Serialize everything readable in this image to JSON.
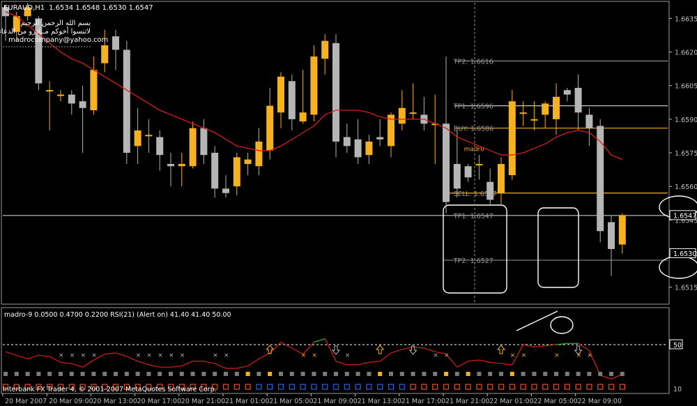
{
  "chart_data": {
    "type": "candlestick",
    "header": {
      "symbol": "EURAUD,H1",
      "ohlc": "1.6534 1.6548 1.6530 1.6547",
      "line1": "بسم الله الرحمن الرحيم",
      "line2": "لاتنسوا أخوكم مــادرو من الدعاء",
      "line3": "madrocompany@yahoo.com"
    },
    "ylim": [
      1.6508,
      1.6642
    ],
    "y_ticks": [
      "1.6650",
      "1.6635",
      "1.6620",
      "1.6605",
      "1.6590",
      "1.6575",
      "1.6560",
      "1.6545",
      "1.6530",
      "1.6515"
    ],
    "y_tick_values": [
      1.665,
      1.6635,
      1.662,
      1.6605,
      1.659,
      1.6575,
      1.656,
      1.6545,
      1.653,
      1.6515
    ],
    "price_badges": [
      {
        "label": "1.6547",
        "value": 1.6547
      },
      {
        "label": "1.6530",
        "value": 1.653
      }
    ],
    "x_ticks": [
      "20 Mar 2007",
      "20 Mar 09:00",
      "20 Mar 13:00",
      "20 Mar 17:00",
      "20 Mar 21:00",
      "21 Mar 01:00",
      "21 Mar 05:00",
      "21 Mar 09:00",
      "21 Mar 13:00",
      "21 Mar 17:00",
      "21 Mar 21:00",
      "22 Mar 01:00",
      "22 Mar 05:00",
      "22 Mar 09:00"
    ],
    "candles": [
      [
        1.664,
        1.6636,
        1.6641,
        1.6625
      ],
      [
        1.6629,
        1.6636,
        1.6638,
        1.6625
      ],
      [
        1.6636,
        1.664,
        1.6642,
        1.6634
      ],
      [
        1.6635,
        1.6606,
        1.6636,
        1.6603
      ],
      [
        1.6603,
        1.6603,
        1.6607,
        1.6585
      ],
      [
        1.6601,
        1.6601,
        1.6603,
        1.6598
      ],
      [
        1.6601,
        1.6597,
        1.6603,
        1.6592
      ],
      [
        1.6598,
        1.6595,
        1.6605,
        1.6575
      ],
      [
        1.6594,
        1.6612,
        1.6618,
        1.6592
      ],
      [
        1.6615,
        1.6623,
        1.663,
        1.6611
      ],
      [
        1.6627,
        1.6621,
        1.663,
        1.6612
      ],
      [
        1.6621,
        1.6575,
        1.6625,
        1.657
      ],
      [
        1.6578,
        1.6585,
        1.6595,
        1.657
      ],
      [
        1.6583,
        1.6583,
        1.659,
        1.6575
      ],
      [
        1.6582,
        1.6574,
        1.6585,
        1.6567
      ],
      [
        1.657,
        1.6569,
        1.6575,
        1.656
      ],
      [
        1.6569,
        1.657,
        1.6575,
        1.656
      ],
      [
        1.6569,
        1.6586,
        1.6589,
        1.6568
      ],
      [
        1.6586,
        1.6574,
        1.659,
        1.657
      ],
      [
        1.6575,
        1.6559,
        1.6578,
        1.6555
      ],
      [
        1.6559,
        1.6557,
        1.6565,
        1.6555
      ],
      [
        1.656,
        1.6573,
        1.6575,
        1.6556
      ],
      [
        1.657,
        1.6572,
        1.6575,
        1.6565
      ],
      [
        1.6569,
        1.658,
        1.6586,
        1.6565
      ],
      [
        1.6576,
        1.6596,
        1.6604,
        1.6572
      ],
      [
        1.6593,
        1.6609,
        1.6611,
        1.6586
      ],
      [
        1.6607,
        1.659,
        1.661,
        1.6585
      ],
      [
        1.6589,
        1.6593,
        1.6612,
        1.6588
      ],
      [
        1.6592,
        1.6618,
        1.6623,
        1.6589
      ],
      [
        1.6617,
        1.6625,
        1.6628,
        1.661
      ],
      [
        1.6624,
        1.658,
        1.6628,
        1.6573
      ],
      [
        1.6582,
        1.6578,
        1.6588,
        1.6575
      ],
      [
        1.6581,
        1.6573,
        1.659,
        1.657
      ],
      [
        1.6574,
        1.658,
        1.6583,
        1.657
      ],
      [
        1.6582,
        1.6581,
        1.659,
        1.6578
      ],
      [
        1.6578,
        1.6592,
        1.6593,
        1.6573
      ],
      [
        1.6588,
        1.6595,
        1.6603,
        1.6585
      ],
      [
        1.6593,
        1.6593,
        1.6606,
        1.659
      ],
      [
        1.6592,
        1.6588,
        1.66,
        1.6585
      ],
      [
        1.6588,
        1.6588,
        1.6601,
        1.657
      ],
      [
        1.6588,
        1.6553,
        1.6618,
        1.6548
      ],
      [
        1.657,
        1.6559,
        1.6585,
        1.6555
      ],
      [
        1.6569,
        1.6564,
        1.657,
        1.6562
      ],
      [
        1.657,
        1.657,
        1.6574,
        1.6563
      ],
      [
        1.6562,
        1.6554,
        1.6568,
        1.6552
      ],
      [
        1.6557,
        1.657,
        1.6573,
        1.6552
      ],
      [
        1.6565,
        1.6598,
        1.6603,
        1.6563
      ],
      [
        1.6593,
        1.6593,
        1.6598,
        1.6587
      ],
      [
        1.659,
        1.659,
        1.6598,
        1.6585
      ],
      [
        1.6592,
        1.6597,
        1.6598,
        1.6586
      ],
      [
        1.659,
        1.66,
        1.6606,
        1.6583
      ],
      [
        1.6603,
        1.6601,
        1.6604,
        1.6598
      ],
      [
        1.6604,
        1.6593,
        1.661,
        1.6585
      ],
      [
        1.6592,
        1.6586,
        1.6595,
        1.6578
      ],
      [
        1.6587,
        1.654,
        1.659,
        1.6535
      ],
      [
        1.6544,
        1.6532,
        1.6547,
        1.652
      ],
      [
        1.6534,
        1.6547,
        1.6548,
        1.653
      ]
    ],
    "ma_series": {
      "name": "",
      "values": [
        1.6638,
        1.6636,
        1.6632,
        1.6628,
        1.6624,
        1.662,
        1.6617,
        1.6615,
        1.6612,
        1.6609,
        1.6606,
        1.6603,
        1.66,
        1.6597,
        1.6594,
        1.6592,
        1.659,
        1.6588,
        1.6586,
        1.6584,
        1.6581,
        1.6578,
        1.6577,
        1.6576,
        1.6576,
        1.6578,
        1.6581,
        1.6584,
        1.6587,
        1.6592,
        1.6594,
        1.6594,
        1.6594,
        1.6593,
        1.6591,
        1.659,
        1.659,
        1.659,
        1.659,
        1.6588,
        1.6586,
        1.6582,
        1.658,
        1.6578,
        1.6576,
        1.6574,
        1.6574,
        1.6575,
        1.6577,
        1.6579,
        1.6582,
        1.6584,
        1.6585,
        1.6584,
        1.658,
        1.6574,
        1.6572
      ]
    },
    "levels": [
      {
        "label": "TP2: 1.6616",
        "value": 1.6616,
        "color": "#9a9a9a",
        "start": 41
      },
      {
        "label": "TP1: 1.6596",
        "value": 1.6596,
        "color": "#c8c8c8",
        "start": 41
      },
      {
        "label": "BUY: 1.6586",
        "value": 1.6586,
        "color": "#f5b120",
        "start": 41
      },
      {
        "label": "SELL: 1.6557",
        "value": 1.6557,
        "color": "#f5b120",
        "start": 40
      },
      {
        "label": "TP1: 1.6547",
        "value": 1.6547,
        "color": "#b4b4b4",
        "start": 0
      },
      {
        "label": "TP2: 1.6527",
        "value": 1.6527,
        "color": "#7a7a7a",
        "start": 40
      }
    ],
    "signal_label": "madro",
    "colors": {
      "bull": "#f5b120",
      "bear": "#b5b5b5",
      "ma": "#d8201a",
      "axis": "#c0c0c0",
      "rsi_up": "#22c422",
      "rsi_down": "#d8201a",
      "arrow": "#f5b120"
    },
    "indicator": {
      "title": "madro-9 0.0500 0.4700 0.2200  RSI(21) (Alert on) 41.40 41.40 50.00",
      "ylim": [
        10,
        80
      ],
      "level": 50,
      "level_label": "50",
      "bottom_label": "10",
      "rsi": [
        44,
        41,
        38,
        41,
        40,
        35,
        34,
        31,
        37,
        42,
        43,
        40,
        36,
        33,
        31,
        31,
        32,
        36,
        36,
        34,
        30,
        30,
        32,
        38,
        43,
        52,
        47,
        42,
        52,
        55,
        36,
        33,
        33,
        35,
        36,
        43,
        46,
        48,
        47,
        44,
        42,
        31,
        36,
        37,
        35,
        34,
        33,
        50,
        48,
        49,
        50,
        51,
        51,
        45,
        24,
        21,
        25
      ],
      "up_arrows": [
        24,
        34,
        45
      ],
      "down_arrows": [
        30,
        37,
        52
      ],
      "x_marks": [
        5,
        6,
        7,
        8,
        12,
        13,
        14,
        15,
        16,
        19,
        20,
        27,
        28,
        31,
        39,
        40,
        46,
        47,
        50,
        52,
        53
      ]
    },
    "squares_row1": [
      "#7a7a7a",
      "#7a7a7a",
      "#7a7a7a",
      "#7a7a7a",
      "#7a7a7a",
      "#7a7a7a",
      "#7a7a7a",
      "#7a7a7a",
      "#7a7a7a",
      "#7a7a7a",
      "#7a7a7a",
      "#7a7a7a",
      "#7a7a7a",
      "#7a7a7a",
      "#7a7a7a",
      "#7a7a7a",
      "#7a7a7a",
      "#7a7a7a",
      "#7a7a7a",
      "#7a7a7a",
      "#7a7a7a",
      "#7a7a7a",
      "#f5b120",
      "#7a7a7a",
      "#f5b120",
      "#7a7a7a",
      "#7a7a7a",
      "#7a7a7a",
      "#7a7a7a",
      "#7a7a7a",
      "#7a7a7a",
      "#7a7a7a",
      "#7a7a7a",
      "#7a7a7a",
      "#f5b120",
      "#7a7a7a",
      "#7a7a7a",
      "#7a7a7a",
      "#7a7a7a",
      "#7a7a7a",
      "#f5b120",
      "#7a7a7a",
      "#f5b120",
      "#7a7a7a",
      "#7a7a7a",
      "#7a7a7a",
      "#f5b120",
      "#7a7a7a",
      "#7a7a7a",
      "#7a7a7a",
      "#7a7a7a",
      "#7a7a7a",
      "#7a7a7a",
      "#7a7a7a",
      "#7a7a7a",
      "#7a7a7a",
      "#7a7a7a"
    ],
    "squares_row2": [
      "#d84828",
      "#d84828",
      "#d84828",
      "#d84828",
      "#d84828",
      "#d84828",
      "#d84828",
      "#d84828",
      "#d84828",
      "#d84828",
      "#d84828",
      "#d84828",
      "#d84828",
      "#d84828",
      "#d84828",
      "#d84828",
      "#d84828",
      "#d84828",
      "#d84828",
      "#d84828",
      "#d84828",
      "#d84828",
      "#d84828",
      "#2a5ad0",
      "#2a5ad0",
      "#2a5ad0",
      "#2a5ad0",
      "#2a5ad0",
      "#2a5ad0",
      "#2a5ad0",
      "#2a5ad0",
      "#2a5ad0",
      "#2a5ad0",
      "#2a5ad0",
      "#2a5ad0",
      "#2a5ad0",
      "#2a5ad0",
      "#d84828",
      "#d84828",
      "#d84828",
      "#d84828",
      "#d84828",
      "#d84828",
      "#d84828",
      "#d84828",
      "#d84828",
      "#d84828",
      "#d84828",
      "#d84828",
      "#d84828",
      "#d84828",
      "#d84828",
      "#d84828",
      "#d84828",
      "#d84828",
      "#d84828",
      "#d84828"
    ],
    "footer": "Interbank FX Trader 4, © 2001-2007 MetaQuotes Software Corp."
  }
}
